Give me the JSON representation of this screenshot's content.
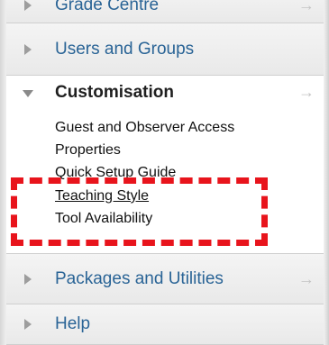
{
  "sidebar": {
    "sections": [
      {
        "label": "Grade Centre",
        "state": "collapsed"
      },
      {
        "label": "Users and Groups",
        "state": "collapsed"
      },
      {
        "label": "Packages and Utilities",
        "state": "collapsed"
      },
      {
        "label": "Help",
        "state": "collapsed"
      }
    ],
    "expanded": {
      "title": "Customisation",
      "items": [
        {
          "label": "Guest and Observer Access"
        },
        {
          "label": "Properties"
        },
        {
          "label": "Quick Setup Guide"
        },
        {
          "label": "Teaching Style"
        },
        {
          "label": "Tool Availability"
        }
      ]
    },
    "arrow_glyph": "→"
  },
  "colors": {
    "link": "#2a6496",
    "highlight_box": "#e8141c"
  }
}
